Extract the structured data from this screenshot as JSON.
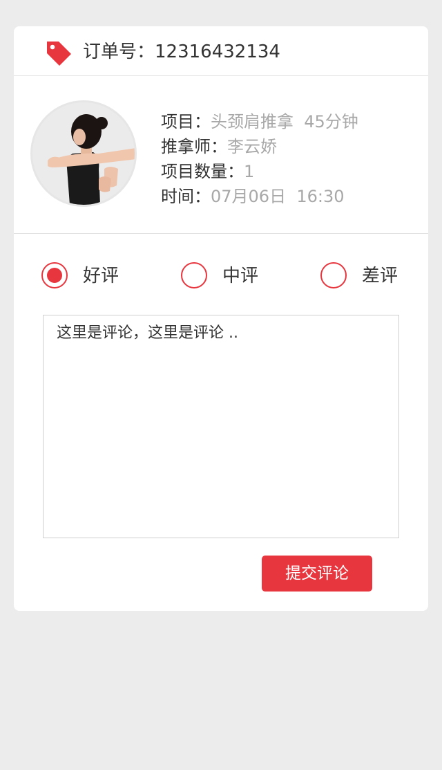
{
  "accent_color": "#e8363f",
  "order": {
    "label": "订单号：",
    "number": "12316432134",
    "icon": "tag-icon"
  },
  "details": {
    "project_label": "项目：",
    "project_value": "头颈肩推拿  45分钟",
    "therapist_label": "推拿师：",
    "therapist_value": "李云娇",
    "quantity_label": "项目数量：",
    "quantity_value": "1",
    "time_label": "时间：",
    "time_value": "07月06日  16:30"
  },
  "rating": {
    "options": [
      {
        "label": "好评",
        "selected": true
      },
      {
        "label": "中评",
        "selected": false
      },
      {
        "label": "差评",
        "selected": false
      }
    ]
  },
  "comment": {
    "value": "这里是评论，这里是评论 .."
  },
  "submit": {
    "label": "提交评论"
  }
}
